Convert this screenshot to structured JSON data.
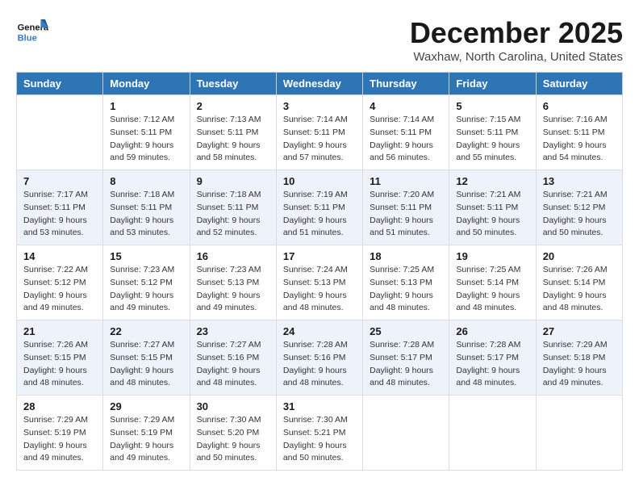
{
  "logo": {
    "line1": "General",
    "line2": "Blue"
  },
  "title": "December 2025",
  "subtitle": "Waxhaw, North Carolina, United States",
  "weekdays": [
    "Sunday",
    "Monday",
    "Tuesday",
    "Wednesday",
    "Thursday",
    "Friday",
    "Saturday"
  ],
  "weeks": [
    [
      {
        "day": "",
        "info": ""
      },
      {
        "day": "1",
        "info": "Sunrise: 7:12 AM\nSunset: 5:11 PM\nDaylight: 9 hours\nand 59 minutes."
      },
      {
        "day": "2",
        "info": "Sunrise: 7:13 AM\nSunset: 5:11 PM\nDaylight: 9 hours\nand 58 minutes."
      },
      {
        "day": "3",
        "info": "Sunrise: 7:14 AM\nSunset: 5:11 PM\nDaylight: 9 hours\nand 57 minutes."
      },
      {
        "day": "4",
        "info": "Sunrise: 7:14 AM\nSunset: 5:11 PM\nDaylight: 9 hours\nand 56 minutes."
      },
      {
        "day": "5",
        "info": "Sunrise: 7:15 AM\nSunset: 5:11 PM\nDaylight: 9 hours\nand 55 minutes."
      },
      {
        "day": "6",
        "info": "Sunrise: 7:16 AM\nSunset: 5:11 PM\nDaylight: 9 hours\nand 54 minutes."
      }
    ],
    [
      {
        "day": "7",
        "info": "Sunrise: 7:17 AM\nSunset: 5:11 PM\nDaylight: 9 hours\nand 53 minutes."
      },
      {
        "day": "8",
        "info": "Sunrise: 7:18 AM\nSunset: 5:11 PM\nDaylight: 9 hours\nand 53 minutes."
      },
      {
        "day": "9",
        "info": "Sunrise: 7:18 AM\nSunset: 5:11 PM\nDaylight: 9 hours\nand 52 minutes."
      },
      {
        "day": "10",
        "info": "Sunrise: 7:19 AM\nSunset: 5:11 PM\nDaylight: 9 hours\nand 51 minutes."
      },
      {
        "day": "11",
        "info": "Sunrise: 7:20 AM\nSunset: 5:11 PM\nDaylight: 9 hours\nand 51 minutes."
      },
      {
        "day": "12",
        "info": "Sunrise: 7:21 AM\nSunset: 5:11 PM\nDaylight: 9 hours\nand 50 minutes."
      },
      {
        "day": "13",
        "info": "Sunrise: 7:21 AM\nSunset: 5:12 PM\nDaylight: 9 hours\nand 50 minutes."
      }
    ],
    [
      {
        "day": "14",
        "info": "Sunrise: 7:22 AM\nSunset: 5:12 PM\nDaylight: 9 hours\nand 49 minutes."
      },
      {
        "day": "15",
        "info": "Sunrise: 7:23 AM\nSunset: 5:12 PM\nDaylight: 9 hours\nand 49 minutes."
      },
      {
        "day": "16",
        "info": "Sunrise: 7:23 AM\nSunset: 5:13 PM\nDaylight: 9 hours\nand 49 minutes."
      },
      {
        "day": "17",
        "info": "Sunrise: 7:24 AM\nSunset: 5:13 PM\nDaylight: 9 hours\nand 48 minutes."
      },
      {
        "day": "18",
        "info": "Sunrise: 7:25 AM\nSunset: 5:13 PM\nDaylight: 9 hours\nand 48 minutes."
      },
      {
        "day": "19",
        "info": "Sunrise: 7:25 AM\nSunset: 5:14 PM\nDaylight: 9 hours\nand 48 minutes."
      },
      {
        "day": "20",
        "info": "Sunrise: 7:26 AM\nSunset: 5:14 PM\nDaylight: 9 hours\nand 48 minutes."
      }
    ],
    [
      {
        "day": "21",
        "info": "Sunrise: 7:26 AM\nSunset: 5:15 PM\nDaylight: 9 hours\nand 48 minutes."
      },
      {
        "day": "22",
        "info": "Sunrise: 7:27 AM\nSunset: 5:15 PM\nDaylight: 9 hours\nand 48 minutes."
      },
      {
        "day": "23",
        "info": "Sunrise: 7:27 AM\nSunset: 5:16 PM\nDaylight: 9 hours\nand 48 minutes."
      },
      {
        "day": "24",
        "info": "Sunrise: 7:28 AM\nSunset: 5:16 PM\nDaylight: 9 hours\nand 48 minutes."
      },
      {
        "day": "25",
        "info": "Sunrise: 7:28 AM\nSunset: 5:17 PM\nDaylight: 9 hours\nand 48 minutes."
      },
      {
        "day": "26",
        "info": "Sunrise: 7:28 AM\nSunset: 5:17 PM\nDaylight: 9 hours\nand 48 minutes."
      },
      {
        "day": "27",
        "info": "Sunrise: 7:29 AM\nSunset: 5:18 PM\nDaylight: 9 hours\nand 49 minutes."
      }
    ],
    [
      {
        "day": "28",
        "info": "Sunrise: 7:29 AM\nSunset: 5:19 PM\nDaylight: 9 hours\nand 49 minutes."
      },
      {
        "day": "29",
        "info": "Sunrise: 7:29 AM\nSunset: 5:19 PM\nDaylight: 9 hours\nand 49 minutes."
      },
      {
        "day": "30",
        "info": "Sunrise: 7:30 AM\nSunset: 5:20 PM\nDaylight: 9 hours\nand 50 minutes."
      },
      {
        "day": "31",
        "info": "Sunrise: 7:30 AM\nSunset: 5:21 PM\nDaylight: 9 hours\nand 50 minutes."
      },
      {
        "day": "",
        "info": ""
      },
      {
        "day": "",
        "info": ""
      },
      {
        "day": "",
        "info": ""
      }
    ]
  ]
}
